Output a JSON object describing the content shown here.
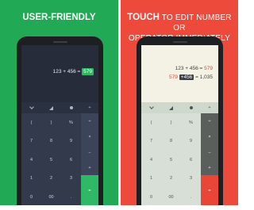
{
  "left_panel": {
    "caption": "USER-FRIENDLY",
    "accent": "#22a955",
    "display": {
      "expression": "123 + 456 =",
      "result": "579"
    }
  },
  "right_panel": {
    "caption_bold": "TOUCH",
    "caption_rest_line1": "TO EDIT NUMBER OR",
    "caption_line2": "OPERATOR IMMEDIATELY",
    "accent": "#ee4a3c",
    "display": {
      "line1_expression": "123 + 456 =",
      "line1_result": "579",
      "line2_operand": "579",
      "line2_operator": "+456",
      "line2_rest": "= 1,035"
    }
  },
  "keypad": {
    "top_row": [
      "chevron-down-icon",
      "signal-icon",
      "dot-icon"
    ],
    "top_row_right": "+",
    "row1": [
      "(",
      ")",
      "%"
    ],
    "row2": [
      "7",
      "8",
      "9"
    ],
    "row3": [
      "4",
      "5",
      "6"
    ],
    "row4": [
      "1",
      "2",
      "3"
    ],
    "row5": [
      "0",
      "00",
      "."
    ],
    "ops": [
      "÷",
      "×",
      "−",
      "+"
    ],
    "equals": "="
  }
}
